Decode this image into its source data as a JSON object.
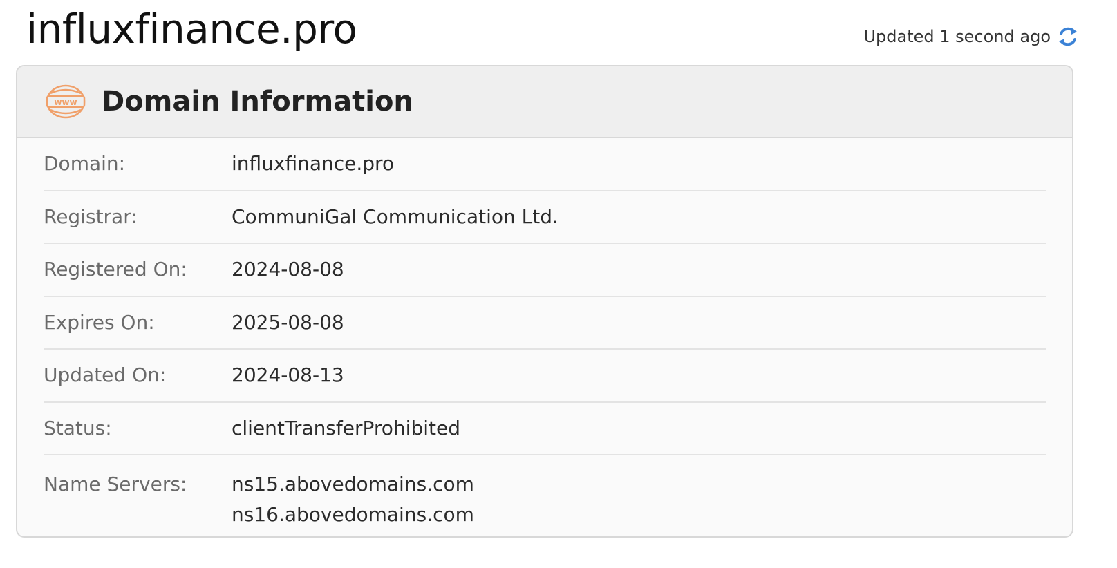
{
  "page_title": "influxfinance.pro",
  "updated": {
    "text": "Updated 1 second ago",
    "icon": "refresh-icon"
  },
  "card": {
    "icon": "www-icon",
    "icon_text": "www",
    "title": "Domain Information",
    "rows": [
      {
        "label": "Domain:",
        "value": "influxfinance.pro"
      },
      {
        "label": "Registrar:",
        "value": "CommuniGal Communication Ltd."
      },
      {
        "label": "Registered On:",
        "value": "2024-08-08"
      },
      {
        "label": "Expires On:",
        "value": "2025-08-08"
      },
      {
        "label": "Updated On:",
        "value": "2024-08-13"
      },
      {
        "label": "Status:",
        "value": "clientTransferProhibited"
      }
    ],
    "name_servers": {
      "label": "Name Servers:",
      "values": [
        "ns15.abovedomains.com",
        "ns16.abovedomains.com"
      ]
    }
  },
  "colors": {
    "accent_orange": "#f0a06a",
    "refresh_blue": "#3b82d6",
    "header_bg": "#efefef",
    "card_bg": "#fafafa",
    "border": "#d8d8d8"
  }
}
